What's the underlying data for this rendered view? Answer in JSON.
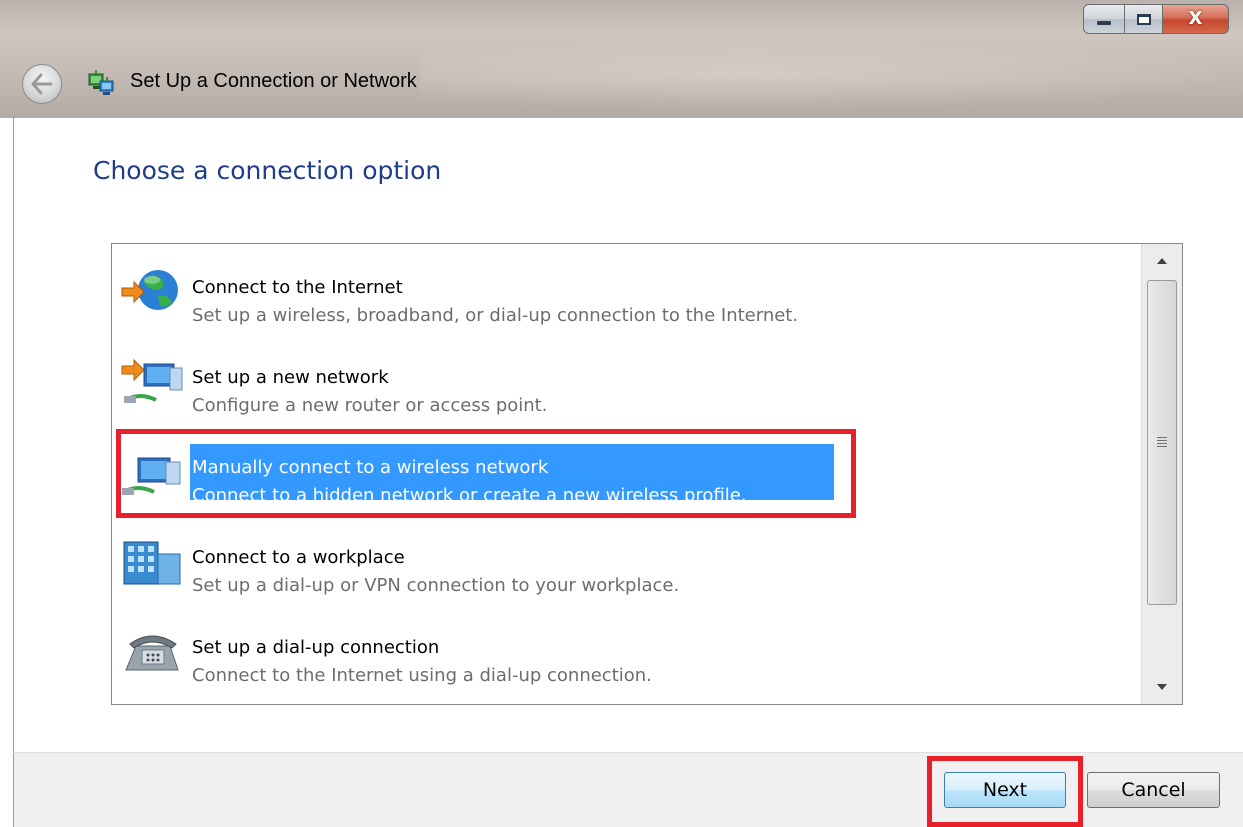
{
  "window": {
    "title": "Set Up a Connection or Network",
    "controls": {
      "minimize": "minimize",
      "maximize": "maximize",
      "close": "X"
    }
  },
  "page": {
    "heading": "Choose a connection option"
  },
  "options": [
    {
      "title": "Connect to the Internet",
      "description": "Set up a wireless, broadband, or dial-up connection to the Internet.",
      "icon": "globe-internet-icon",
      "selected": false
    },
    {
      "title": "Set up a new network",
      "description": "Configure a new router or access point.",
      "icon": "new-network-icon",
      "selected": false
    },
    {
      "title": "Manually connect to a wireless network",
      "description": "Connect to a hidden network or create a new wireless profile.",
      "icon": "wireless-network-icon",
      "selected": true
    },
    {
      "title": "Connect to a workplace",
      "description": "Set up a dial-up or VPN connection to your workplace.",
      "icon": "workplace-building-icon",
      "selected": false
    },
    {
      "title": "Set up a dial-up connection",
      "description": "Connect to the Internet using a dial-up connection.",
      "icon": "telephone-modem-icon",
      "selected": false
    }
  ],
  "buttons": {
    "next": "Next",
    "cancel": "Cancel"
  },
  "colors": {
    "heading": "#1e3e8c",
    "selection": "#3399ff",
    "annotation_highlight": "#e8202a"
  }
}
